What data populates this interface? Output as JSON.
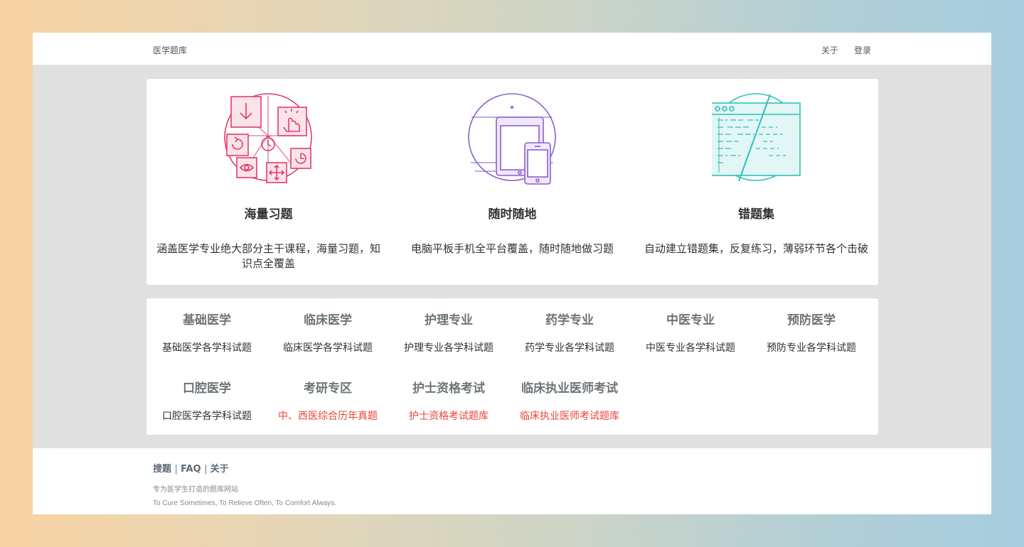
{
  "navbar": {
    "brand": "医学题库",
    "links": [
      "关于",
      "登录"
    ]
  },
  "features": [
    {
      "icon": "practice-icon",
      "color": "#e13c6c",
      "title": "海量习题",
      "desc": "涵盖医学专业绝大部分主干课程，海量习题，知识点全覆盖"
    },
    {
      "icon": "devices-icon",
      "color": "#8a5fd0",
      "title": "随时随地",
      "desc": "电脑平板手机全平台覆盖，随时随地做习题"
    },
    {
      "icon": "wrong-answers-icon",
      "color": "#2ec1b9",
      "title": "错题集",
      "desc": "自动建立错题集，反复练习，薄弱环节各个击破"
    }
  ],
  "subjects": {
    "row1": [
      {
        "name": "基础医学",
        "desc": "基础医学各学科试题",
        "highlight": false
      },
      {
        "name": "临床医学",
        "desc": "临床医学各学科试题",
        "highlight": false
      },
      {
        "name": "护理专业",
        "desc": "护理专业各学科试题",
        "highlight": false
      },
      {
        "name": "药学专业",
        "desc": "药学专业各学科试题",
        "highlight": false
      },
      {
        "name": "中医专业",
        "desc": "中医专业各学科试题",
        "highlight": false
      },
      {
        "name": "预防医学",
        "desc": "预防专业各学科试题",
        "highlight": false
      }
    ],
    "row2": [
      {
        "name": "口腔医学",
        "desc": "口腔医学各学科试题",
        "highlight": false
      },
      {
        "name": "考研专区",
        "desc": "中、西医综合历年真题",
        "highlight": true
      },
      {
        "name": "护士资格考试",
        "desc": "护士资格考试题库",
        "highlight": true
      },
      {
        "name": "临床执业医师考试",
        "desc": "临床执业医师考试题库",
        "highlight": true
      }
    ]
  },
  "footer": {
    "links": [
      "搜题",
      "FAQ",
      "关于"
    ],
    "tagline": "专为医学生打造的题库网站",
    "motto": "To Cure Sometimes, To Relieve Often, To Comfort Always."
  }
}
